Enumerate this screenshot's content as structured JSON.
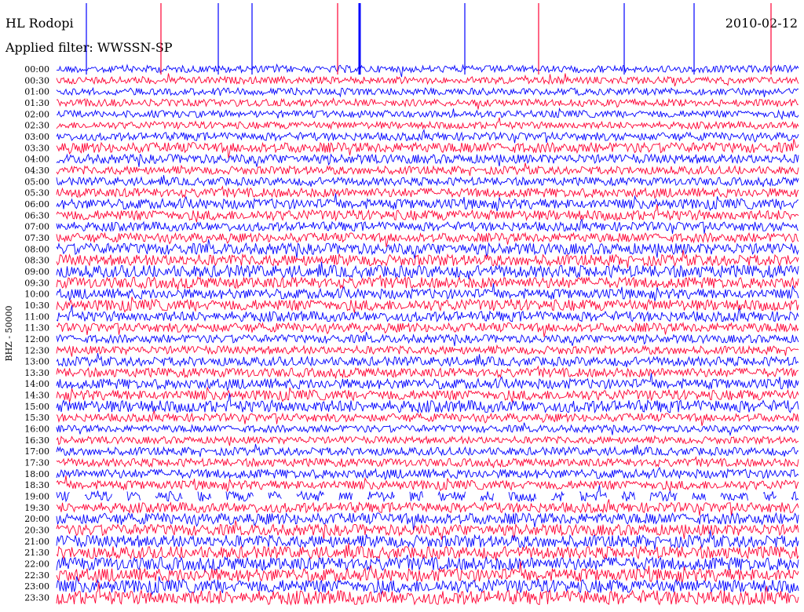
{
  "station": "HL Rodopi",
  "date": "2010-02-12",
  "filter_label": "Applied filter: WWSSN-SP",
  "channel_label": "BHZ - 50000",
  "colors": {
    "trace_a": "#0000ff",
    "trace_b": "#ff0033",
    "background": "#ffffff",
    "text": "#000000"
  },
  "chart_data": {
    "type": "line",
    "title": "HL Rodopi",
    "subtitle": "Applied filter: WWSSN-SP",
    "ylabel": "BHZ - 50000",
    "xlabel": "",
    "grid": false,
    "row_labels": [
      "00:00",
      "00:30",
      "01:00",
      "01:30",
      "02:00",
      "02:30",
      "03:00",
      "03:30",
      "04:00",
      "04:30",
      "05:00",
      "05:30",
      "06:00",
      "06:30",
      "07:00",
      "07:30",
      "08:00",
      "08:30",
      "09:00",
      "09:30",
      "10:00",
      "10:30",
      "11:00",
      "11:30",
      "12:00",
      "12:30",
      "13:00",
      "13:30",
      "14:00",
      "14:30",
      "15:00",
      "15:30",
      "16:00",
      "16:30",
      "17:00",
      "17:30",
      "18:00",
      "18:30",
      "19:00",
      "19:30",
      "20:00",
      "20:30",
      "21:00",
      "21:30",
      "22:00",
      "22:30",
      "23:00",
      "23:30"
    ],
    "series": [
      {
        "color": "trace_a"
      },
      {
        "color": "trace_b"
      }
    ],
    "row_colors": [
      "trace_a",
      "trace_b"
    ],
    "row_amplitude": [
      0.35,
      0.35,
      0.35,
      0.35,
      0.35,
      0.35,
      0.4,
      0.5,
      0.45,
      0.4,
      0.4,
      0.45,
      0.5,
      0.5,
      0.45,
      0.45,
      0.55,
      0.55,
      0.6,
      0.55,
      0.5,
      0.55,
      0.5,
      0.45,
      0.4,
      0.4,
      0.45,
      0.45,
      0.5,
      0.5,
      0.6,
      0.4,
      0.35,
      0.35,
      0.4,
      0.4,
      0.45,
      0.45,
      0.5,
      0.5,
      0.55,
      0.55,
      0.6,
      0.6,
      0.65,
      0.65,
      0.65,
      0.7
    ],
    "data_gap_row": "19:00"
  }
}
